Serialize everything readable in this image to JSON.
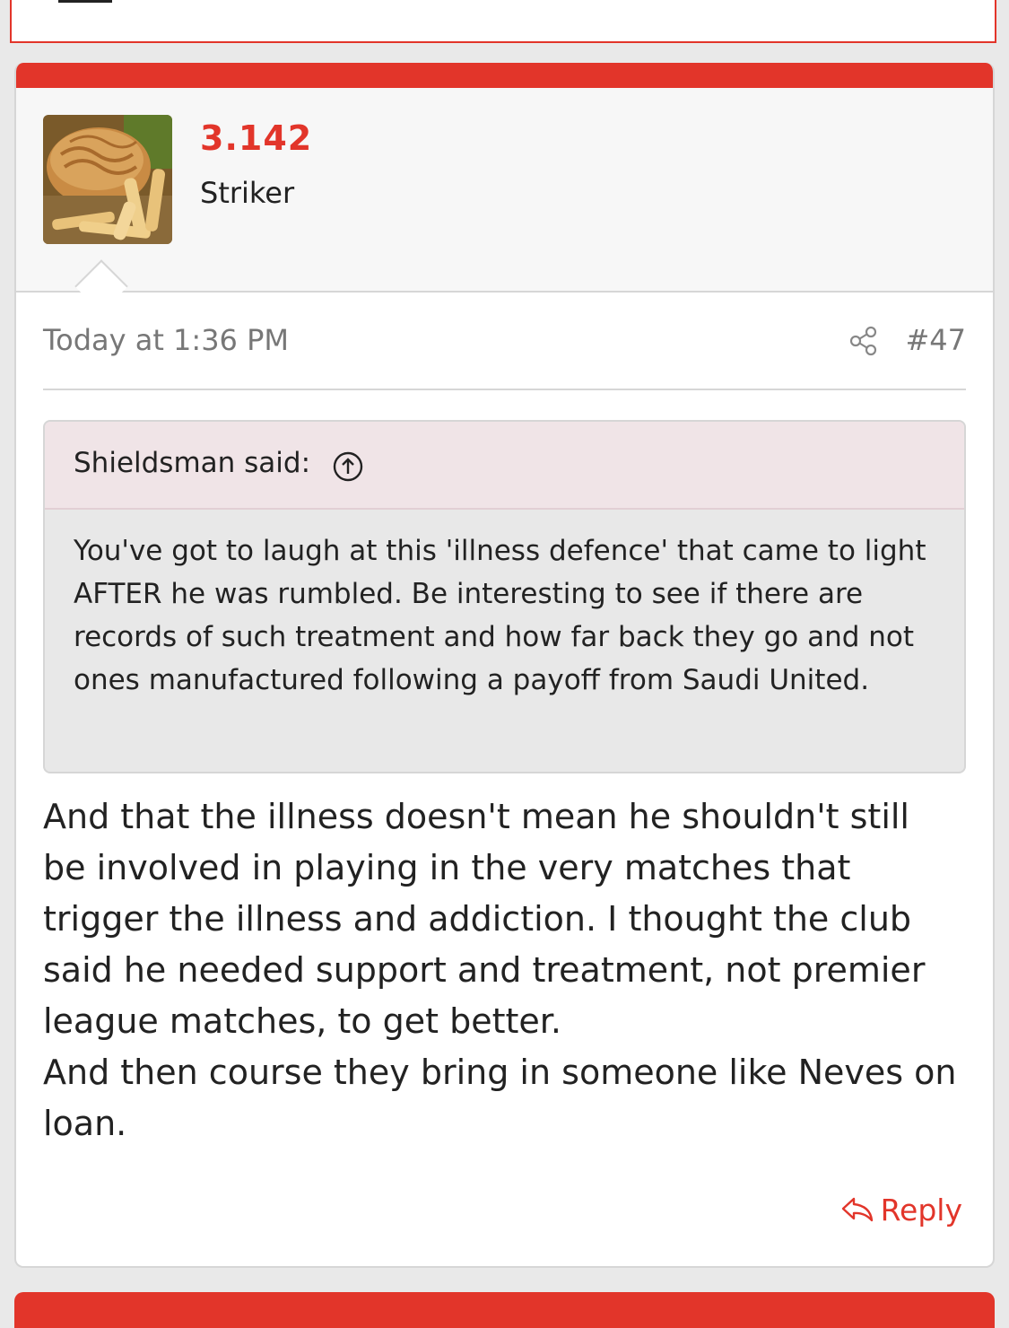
{
  "colors": {
    "accent": "#e2352a",
    "quote_header_bg": "#f0e4e7",
    "quote_body_bg": "#e8e8e8",
    "muted_text": "#777777"
  },
  "post": {
    "user": {
      "name": "3.142",
      "title": "Striker",
      "avatar_icon": "pie-and-chips-avatar"
    },
    "date": "Today at 1:36 PM",
    "share_icon": "share-icon",
    "number": "#47",
    "quote": {
      "author_line": "Shieldsman said:",
      "jump_icon": "arrow-up-circle-icon",
      "text": "You've got to laugh at this 'illness defence' that came to light AFTER he was rumbled. Be interesting to see if there are records of such treatment and how far back they go and not ones manufactured following a payoff from Saudi United."
    },
    "body": [
      "And that the illness doesn't mean he shouldn't still be involved in playing in the very matches that trigger the illness and addiction. I thought the club said he needed support and treatment, not premier league matches, to get better.",
      "And then course they bring in someone like Neves on loan."
    ],
    "reply_label": "Reply",
    "reply_icon": "reply-arrow-icon"
  }
}
